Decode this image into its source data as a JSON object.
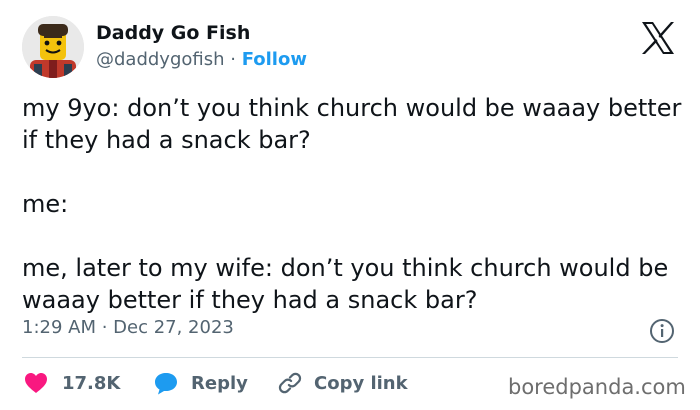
{
  "author": {
    "display_name": "Daddy Go Fish",
    "handle": "@daddygofish",
    "separator": " · ",
    "follow_label": "Follow",
    "avatar_icon": "lego-figure-avatar"
  },
  "platform_icon": "x-logo-icon",
  "tweet": {
    "lines": [
      "my 9yo: don’t you think church would be waaay better if they had a snack bar?",
      "me:",
      "me, later to my wife: don’t you think church would be waaay better if they had a snack bar?"
    ],
    "timestamp": "1:29 AM · Dec 27, 2023"
  },
  "actions": {
    "likes": "17.8K",
    "reply_label": "Reply",
    "copy_label": "Copy link"
  },
  "watermark": "boredpanda.com",
  "colors": {
    "text": "#0f1419",
    "secondary": "#536471",
    "accent": "#1d9bf0",
    "like": "#f91880",
    "divider": "#cfd9de"
  }
}
